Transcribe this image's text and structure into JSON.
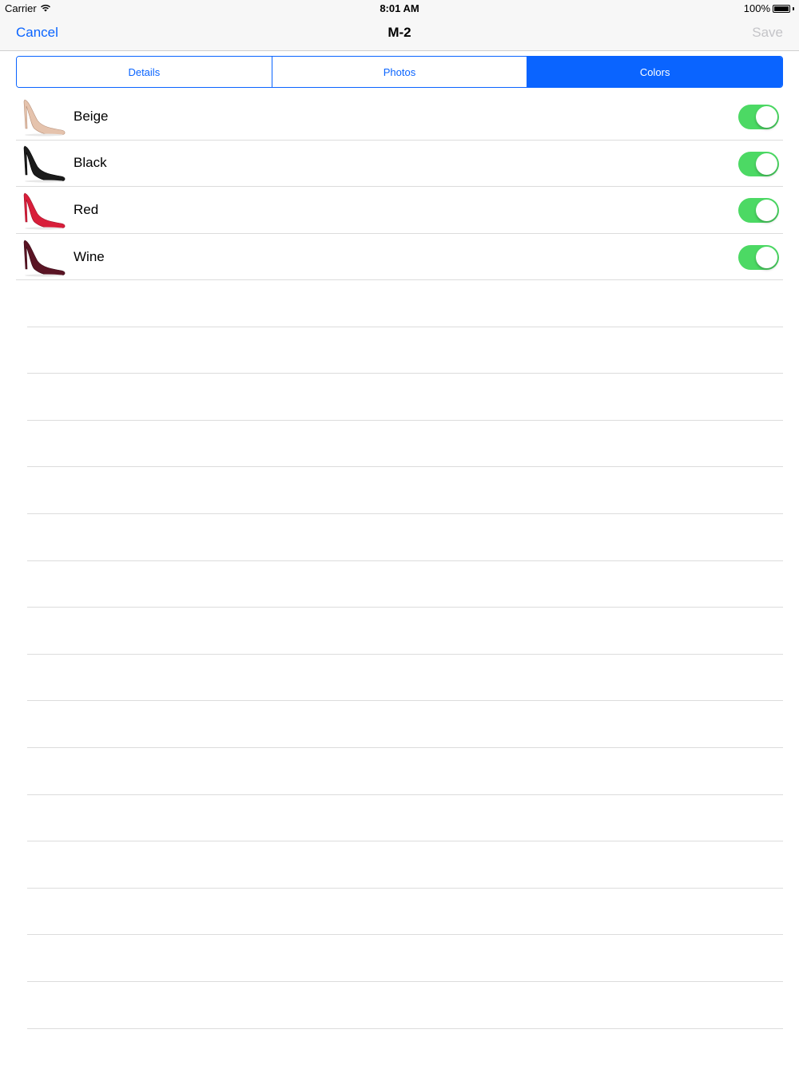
{
  "status_bar": {
    "carrier": "Carrier",
    "time": "8:01 AM",
    "battery": "100%",
    "icons": [
      "wifi-icon",
      "battery-icon"
    ]
  },
  "nav_bar": {
    "cancel_label": "Cancel",
    "title": "M-2",
    "save_label": "Save"
  },
  "tabs": [
    {
      "label": "Details",
      "selected": false
    },
    {
      "label": "Photos",
      "selected": false
    },
    {
      "label": "Colors",
      "selected": true
    }
  ],
  "colors": [
    {
      "label": "Beige",
      "enabled": true,
      "shoe_color": "#e5c3ad"
    },
    {
      "label": "Black",
      "enabled": true,
      "shoe_color": "#1b1b1b"
    },
    {
      "label": "Red",
      "enabled": true,
      "shoe_color": "#d81e3a"
    },
    {
      "label": "Wine",
      "enabled": true,
      "shoe_color": "#5a1424"
    }
  ],
  "theme": {
    "accent": "#0a64ff",
    "toggle_on": "#4cd964",
    "disabled_text": "#c4c4c8"
  }
}
